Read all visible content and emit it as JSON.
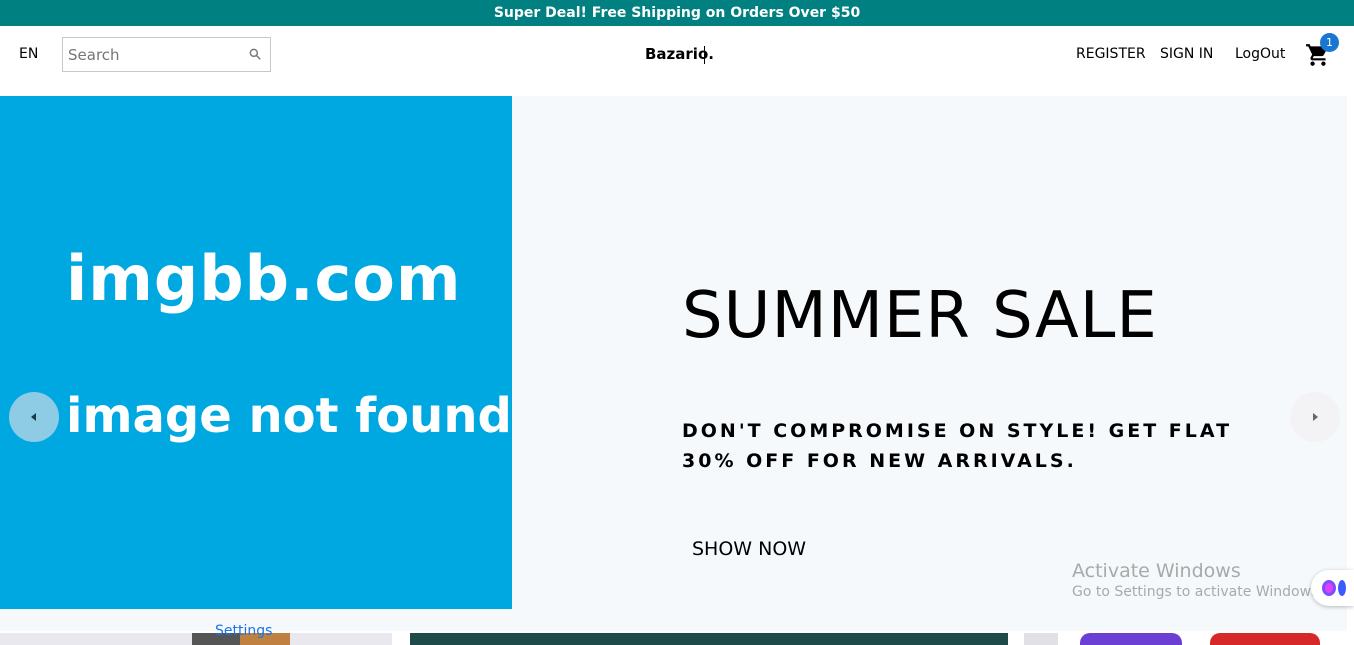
{
  "announcement": {
    "text": "Super Deal! Free Shipping on Orders Over $50"
  },
  "header": {
    "language": "EN",
    "search": {
      "placeholder": "Search",
      "value": ""
    },
    "logo": "Bazario.",
    "links": {
      "register": "REGISTER",
      "sign_in": "SIGN IN",
      "logout": "LogOut"
    },
    "cart": {
      "count": "1"
    }
  },
  "slider": {
    "image": {
      "line1": "imgbb.com",
      "line2": "image not found"
    },
    "title": "SUMMER SALE",
    "description": "DON'T COMPROMISE ON STYLE! GET FLAT 30% OFF FOR NEW ARRIVALS.",
    "button": "SHOW NOW"
  },
  "os_overlay": {
    "title": "Activate Windows",
    "subtitle": "Go to Settings to activate Windows."
  },
  "peek": {
    "settings": "Settings"
  },
  "colors": {
    "announce_bg": "#008080",
    "image_bg": "#00a8e1",
    "slide_bg": "#f5f9fc",
    "badge": "#1976d2"
  }
}
